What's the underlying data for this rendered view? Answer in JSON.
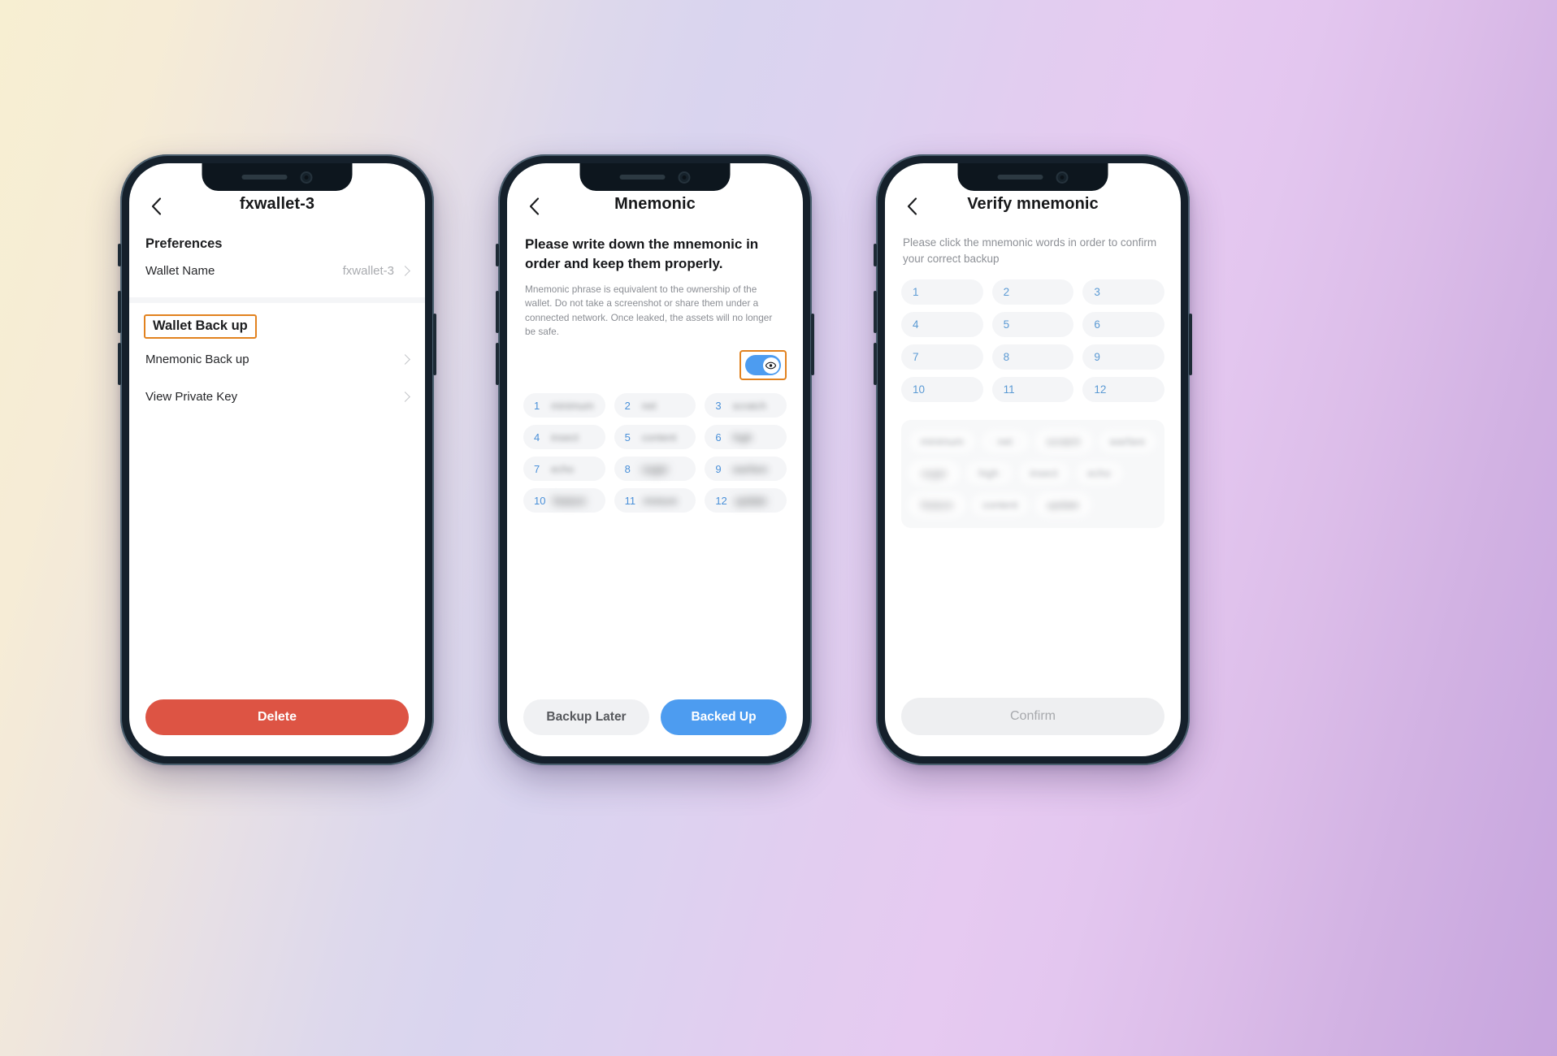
{
  "phones": [
    {
      "id": "wallet-detail",
      "appbar": {
        "title": "fxwallet-3",
        "back_icon": "chevron-left-icon"
      },
      "section_title": "Preferences",
      "rows": [
        {
          "label": "Wallet Name",
          "value": "fxwallet-3",
          "chevron": true
        }
      ],
      "highlight": {
        "label": "Wallet Back up",
        "border_color": "#e2821f"
      },
      "backup_rows": [
        {
          "label": "Mnemonic Back up",
          "value": "",
          "chevron": true
        },
        {
          "label": "View Private Key",
          "value": "",
          "chevron": true
        }
      ],
      "delete_button": {
        "label": "Delete",
        "color": "#dd5444"
      }
    },
    {
      "id": "mnemonic",
      "appbar": {
        "title": "Mnemonic",
        "back_icon": "chevron-left-icon"
      },
      "heading": "Please write down the mnemonic in order and keep them properly.",
      "subtext": "Mnemonic phrase is equivalent to the ownership of the wallet. Do not take a screenshot or share them under a connected network. Once leaked, the assets will no longer be safe.",
      "visibility_toggle": {
        "state": "on",
        "icon": "eye-icon",
        "color": "#4d9cf0",
        "highlight_color": "#e2821f"
      },
      "mnemonic_words": [
        {
          "num": "1",
          "word": "minimum",
          "blur": "blur-s"
        },
        {
          "num": "2",
          "word": "net",
          "blur": "blur-s"
        },
        {
          "num": "3",
          "word": "scratch",
          "blur": "blur-s"
        },
        {
          "num": "4",
          "word": "insect",
          "blur": "blur-s"
        },
        {
          "num": "5",
          "word": "content",
          "blur": "blur-s"
        },
        {
          "num": "6",
          "word": "high",
          "blur": "blur-m"
        },
        {
          "num": "7",
          "word": "echo",
          "blur": "blur-s"
        },
        {
          "num": "8",
          "word": "sugar",
          "blur": "blur-h"
        },
        {
          "num": "9",
          "word": "warfare",
          "blur": "blur-m"
        },
        {
          "num": "10",
          "word": "feature",
          "blur": "blur-h"
        },
        {
          "num": "11",
          "word": "mixture",
          "blur": "blur-m"
        },
        {
          "num": "12",
          "word": "update",
          "blur": "blur-h"
        }
      ],
      "footer_buttons": [
        {
          "label": "Backup Later",
          "style": "ghost",
          "color": "#f0f1f3"
        },
        {
          "label": "Backed Up",
          "style": "primary",
          "color": "#4d9cf0"
        }
      ]
    },
    {
      "id": "verify-mnemonic",
      "appbar": {
        "title": "Verify mnemonic",
        "back_icon": "chevron-left-icon"
      },
      "subtext": "Please click the mnemonic words in order to confirm your correct backup",
      "slots": [
        "1",
        "2",
        "3",
        "4",
        "5",
        "6",
        "7",
        "8",
        "9",
        "10",
        "11",
        "12"
      ],
      "word_bank": [
        {
          "word": "minimum",
          "blur": "blur-s"
        },
        {
          "word": "net",
          "blur": "blur-s"
        },
        {
          "word": "scratch",
          "blur": "blur-m"
        },
        {
          "word": "warfare",
          "blur": "blur-s"
        },
        {
          "word": "sugar",
          "blur": "blur-h"
        },
        {
          "word": "high",
          "blur": "blur-s"
        },
        {
          "word": "insect",
          "blur": "blur-s"
        },
        {
          "word": "echo",
          "blur": "blur-s"
        },
        {
          "word": "feature",
          "blur": "blur-h"
        },
        {
          "word": "content",
          "blur": "blur-s"
        },
        {
          "word": "update",
          "blur": "blur-m"
        }
      ],
      "confirm_button": {
        "label": "Confirm",
        "state": "disabled",
        "color": "#eeeff1"
      }
    }
  ]
}
